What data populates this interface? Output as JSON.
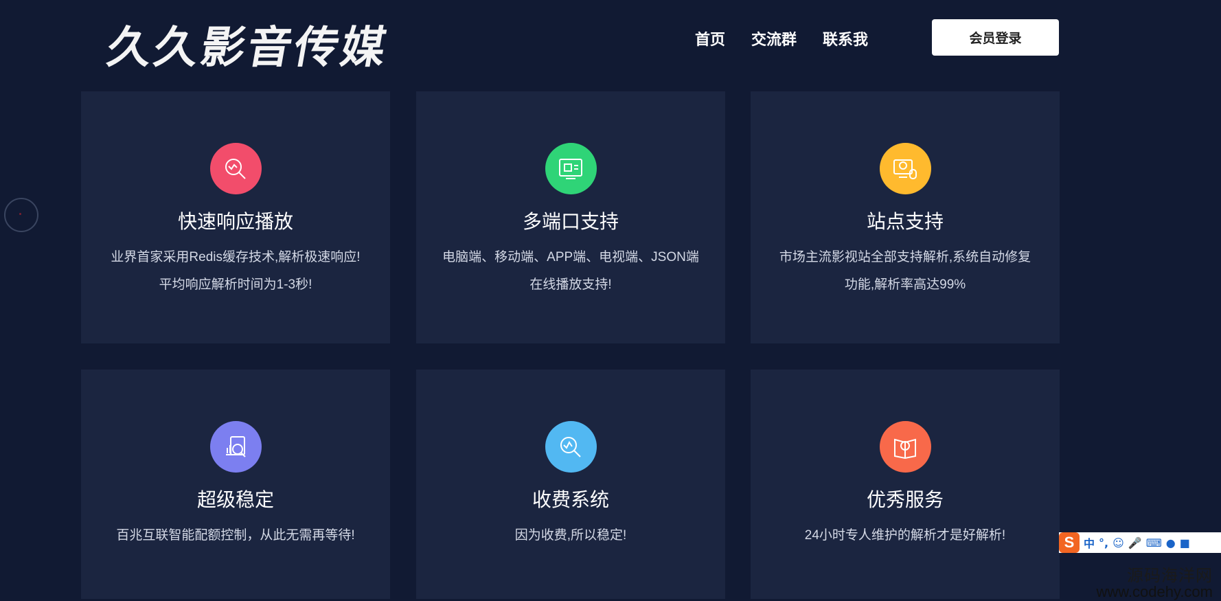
{
  "header": {
    "logo_text": "久久影音传媒",
    "nav": [
      "首页",
      "交流群",
      "联系我"
    ],
    "login_label": "会员登录"
  },
  "features": [
    {
      "title": "快速响应播放",
      "desc_lines": [
        "业界首家采用Redis缓存技术,解析极速响应!",
        "平均响应解析时间为1-3秒!"
      ],
      "icon": "search-chart-icon",
      "color": "#f24d6b"
    },
    {
      "title": "多端口支持",
      "desc_lines": [
        "电脑端、移动端、APP端、电视端、JSON端",
        "在线播放支持!"
      ],
      "icon": "multi-device-icon",
      "color": "#2fd477"
    },
    {
      "title": "站点支持",
      "desc_lines": [
        "市场主流影视站全部支持解析,系统自动修复",
        "功能,解析率高达99%"
      ],
      "icon": "monitor-dollar-icon",
      "color": "#ffba2e"
    },
    {
      "title": "超级稳定",
      "desc_lines": [
        "百兆互联智能配额控制，从此无需再等待!"
      ],
      "icon": "stats-document-icon",
      "color": "#7c7ff0"
    },
    {
      "title": "收费系统",
      "desc_lines": [
        "因为收费,所以稳定!"
      ],
      "icon": "search-analytics-icon",
      "color": "#52b8f2"
    },
    {
      "title": "优秀服务",
      "desc_lines": [
        "24小时专人维护的解析才是好解析!"
      ],
      "icon": "book-search-icon",
      "color": "#f8694a"
    }
  ],
  "ime": {
    "logo": "S",
    "mode": "中",
    "punct": "°,",
    "items": [
      "smiley-icon",
      "mic-icon",
      "keyboard-icon",
      "user-icon",
      "shirt-icon"
    ]
  },
  "watermark": {
    "cn": "源码海洋网",
    "url": "www.codehy.com"
  }
}
